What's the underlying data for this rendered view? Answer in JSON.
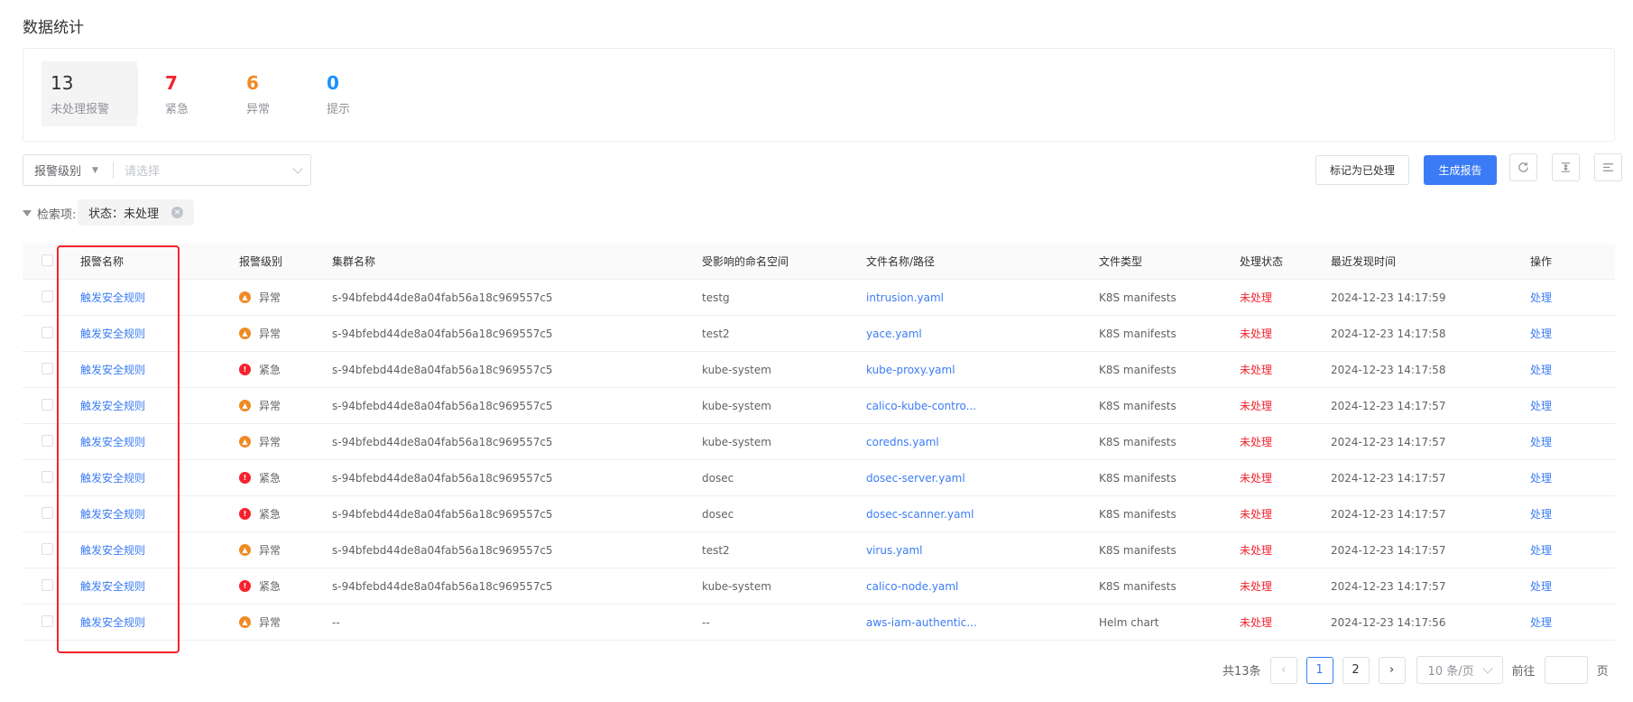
{
  "page_title": "数据统计",
  "stats": {
    "total": {
      "value": "13",
      "label": "未处理报警"
    },
    "urgent": {
      "value": "7",
      "label": "紧急"
    },
    "abnormal": {
      "value": "6",
      "label": "异常"
    },
    "hint": {
      "value": "0",
      "label": "提示"
    }
  },
  "filter": {
    "key_label": "报警级别",
    "value_placeholder": "请选择"
  },
  "toolbar": {
    "mark_handled_label": "标记为已处理",
    "generate_report_label": "生成报告"
  },
  "search_tags": {
    "label": "检索项:",
    "tag": "状态：未处理"
  },
  "table": {
    "headers": {
      "name": "报警名称",
      "level": "报警级别",
      "cluster": "集群名称",
      "namespace": "受影响的命名空间",
      "file": "文件名称/路径",
      "file_type": "文件类型",
      "status": "处理状态",
      "time": "最近发现时间",
      "operation": "操作"
    },
    "rows": [
      {
        "name": "触发安全规则",
        "level": "异常",
        "level_kind": "abnormal",
        "cluster": "s-94bfebd44de8a04fab56a18c969557c5",
        "namespace": "testg",
        "file": "intrusion.yaml",
        "file_type": "K8S manifests",
        "status": "未处理",
        "time": "2024-12-23 14:17:59",
        "operation": "处理"
      },
      {
        "name": "触发安全规则",
        "level": "异常",
        "level_kind": "abnormal",
        "cluster": "s-94bfebd44de8a04fab56a18c969557c5",
        "namespace": "test2",
        "file": "yace.yaml",
        "file_type": "K8S manifests",
        "status": "未处理",
        "time": "2024-12-23 14:17:58",
        "operation": "处理"
      },
      {
        "name": "触发安全规则",
        "level": "紧急",
        "level_kind": "urgent",
        "cluster": "s-94bfebd44de8a04fab56a18c969557c5",
        "namespace": "kube-system",
        "file": "kube-proxy.yaml",
        "file_type": "K8S manifests",
        "status": "未处理",
        "time": "2024-12-23 14:17:58",
        "operation": "处理"
      },
      {
        "name": "触发安全规则",
        "level": "异常",
        "level_kind": "abnormal",
        "cluster": "s-94bfebd44de8a04fab56a18c969557c5",
        "namespace": "kube-system",
        "file": "calico-kube-contro...",
        "file_type": "K8S manifests",
        "status": "未处理",
        "time": "2024-12-23 14:17:57",
        "operation": "处理"
      },
      {
        "name": "触发安全规则",
        "level": "异常",
        "level_kind": "abnormal",
        "cluster": "s-94bfebd44de8a04fab56a18c969557c5",
        "namespace": "kube-system",
        "file": "coredns.yaml",
        "file_type": "K8S manifests",
        "status": "未处理",
        "time": "2024-12-23 14:17:57",
        "operation": "处理"
      },
      {
        "name": "触发安全规则",
        "level": "紧急",
        "level_kind": "urgent",
        "cluster": "s-94bfebd44de8a04fab56a18c969557c5",
        "namespace": "dosec",
        "file": "dosec-server.yaml",
        "file_type": "K8S manifests",
        "status": "未处理",
        "time": "2024-12-23 14:17:57",
        "operation": "处理"
      },
      {
        "name": "触发安全规则",
        "level": "紧急",
        "level_kind": "urgent",
        "cluster": "s-94bfebd44de8a04fab56a18c969557c5",
        "namespace": "dosec",
        "file": "dosec-scanner.yaml",
        "file_type": "K8S manifests",
        "status": "未处理",
        "time": "2024-12-23 14:17:57",
        "operation": "处理"
      },
      {
        "name": "触发安全规则",
        "level": "异常",
        "level_kind": "abnormal",
        "cluster": "s-94bfebd44de8a04fab56a18c969557c5",
        "namespace": "test2",
        "file": "virus.yaml",
        "file_type": "K8S manifests",
        "status": "未处理",
        "time": "2024-12-23 14:17:57",
        "operation": "处理"
      },
      {
        "name": "触发安全规则",
        "level": "紧急",
        "level_kind": "urgent",
        "cluster": "s-94bfebd44de8a04fab56a18c969557c5",
        "namespace": "kube-system",
        "file": "calico-node.yaml",
        "file_type": "K8S manifests",
        "status": "未处理",
        "time": "2024-12-23 14:17:57",
        "operation": "处理"
      },
      {
        "name": "触发安全规则",
        "level": "异常",
        "level_kind": "abnormal",
        "cluster": "--",
        "namespace": "--",
        "file": "aws-iam-authentic...",
        "file_type": "Helm chart",
        "status": "未处理",
        "time": "2024-12-23 14:17:56",
        "operation": "处理"
      }
    ]
  },
  "pagination": {
    "total_text": "共13条",
    "pages": [
      "1",
      "2"
    ],
    "current_page": "1",
    "page_size": "10 条/页",
    "goto_label": "前往",
    "page_suffix": "页"
  },
  "colors": {
    "accent": "#3b7cf6",
    "urgent": "#f5222d",
    "abnormal": "#f08a24",
    "hint": "#1890ff"
  },
  "icons": {
    "refresh": "refresh-icon",
    "density": "density-icon",
    "columns": "columns-icon",
    "filter": "filter-icon"
  }
}
